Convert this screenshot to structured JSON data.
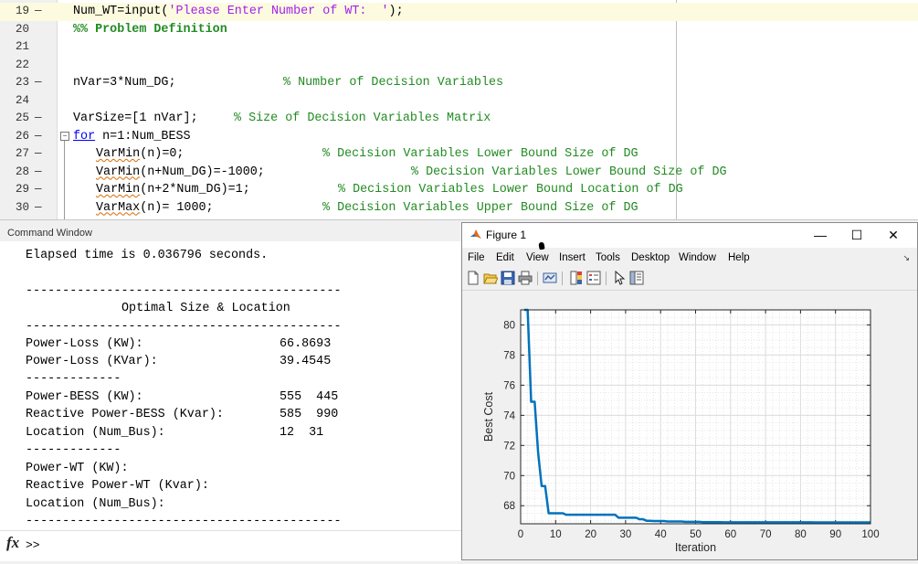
{
  "editor": {
    "lines": [
      {
        "num": "19",
        "dash": "—",
        "code": "Num_WT=input(",
        "str": "'Please Enter Number of WT:  '",
        "tail": ");",
        "highlight": true
      },
      {
        "num": "20",
        "dash": "",
        "section": "%% Problem Definition"
      },
      {
        "num": "21",
        "dash": ""
      },
      {
        "num": "22",
        "dash": ""
      },
      {
        "num": "23",
        "dash": "—",
        "code": "nVar=3*Num_DG;",
        "comment": "% Number of Decision Variables"
      },
      {
        "num": "24",
        "dash": ""
      },
      {
        "num": "25",
        "dash": "—",
        "code": "VarSize=[1 nVar];",
        "comment": "% Size of Decision Variables Matrix"
      },
      {
        "num": "26",
        "dash": "—",
        "kw": "for",
        "code": " n=1:Num_BESS"
      },
      {
        "num": "27",
        "dash": "—",
        "var": "VarMin",
        "code": "(n)=0;",
        "comment": "% Decision Variables Lower Bound Size of DG"
      },
      {
        "num": "28",
        "dash": "—",
        "var": "VarMin",
        "code": "(n+Num_DG)=-1000;",
        "comment": "% Decision Variables Lower Bound Size of DG"
      },
      {
        "num": "29",
        "dash": "—",
        "var": "VarMin",
        "code": "(n+2*Num_DG)=1;",
        "comment": "% Decision Variables Lower Bound Location of DG"
      },
      {
        "num": "30",
        "dash": "—",
        "var": "VarMax",
        "code": "(n)= 1000;",
        "comment": "% Decision Variables Upper Bound Size of DG"
      }
    ]
  },
  "command_window": {
    "title": "Command Window",
    "elapsed": "Elapsed time is 0.036796 seconds.",
    "separator_long": "-------------------------------------------",
    "separator_short": "-------------",
    "header": "Optimal Size & Location",
    "rows": [
      {
        "label": "Power-Loss (KW):",
        "value": "66.8693"
      },
      {
        "label": "Power-Loss (KVar):",
        "value": "39.4545"
      },
      {
        "label": "Power-BESS (KW):",
        "value": "555  445"
      },
      {
        "label": "Reactive Power-BESS (Kvar):",
        "value": "585  990"
      },
      {
        "label": "Location (Num_Bus):",
        "value": "12  31"
      },
      {
        "label": "Power-WT (KW):",
        "value": ""
      },
      {
        "label": "Reactive Power-WT (Kvar):",
        "value": ""
      },
      {
        "label": "Location (Num_Bus):",
        "value": ""
      }
    ],
    "fx_label": "fx",
    "prompt": ">>"
  },
  "figure": {
    "title": "Figure 1",
    "buttons": {
      "minimize": "—",
      "maximize": "☐",
      "close": "✕"
    },
    "menus": [
      "File",
      "Edit",
      "View",
      "Insert",
      "Tools",
      "Desktop",
      "Window",
      "Help"
    ],
    "menu_arrow": "↘",
    "toolbar_icons": [
      "new-figure-icon",
      "open-file-icon",
      "save-icon",
      "print-icon",
      "link-plot-icon",
      "colorbar-icon",
      "legend-icon",
      "pointer-icon",
      "property-editor-icon"
    ],
    "line_color": "#0072bd"
  },
  "chart_data": {
    "type": "line",
    "title": "",
    "xlabel": "Iteration",
    "ylabel": "Best Cost",
    "xlim": [
      0,
      100
    ],
    "ylim": [
      66.8,
      81
    ],
    "xticks": [
      0,
      10,
      20,
      30,
      40,
      50,
      60,
      70,
      80,
      90,
      100
    ],
    "yticks": [
      68,
      70,
      72,
      74,
      76,
      78,
      80
    ],
    "grid": true,
    "series": [
      {
        "name": "",
        "x": [
          1,
          2,
          3,
          4,
          5,
          6,
          7,
          8,
          9,
          10,
          11,
          12,
          13,
          14,
          15,
          16,
          17,
          18,
          19,
          20,
          21,
          22,
          23,
          24,
          25,
          26,
          27,
          28,
          29,
          30,
          31,
          32,
          33,
          34,
          35,
          36,
          37,
          38,
          39,
          40,
          41,
          42,
          43,
          44,
          45,
          46,
          47,
          48,
          49,
          50,
          51,
          52,
          53,
          54,
          55,
          56,
          57,
          58,
          59,
          60,
          61,
          62,
          63,
          64,
          65,
          66,
          67,
          68,
          69,
          70,
          71,
          72,
          73,
          74,
          75,
          76,
          77,
          78,
          79,
          80,
          81,
          82,
          83,
          84,
          85,
          86,
          87,
          88,
          89,
          90,
          91,
          92,
          93,
          94,
          95,
          96,
          97,
          98,
          99,
          100
        ],
        "y": [
          81.0,
          81.0,
          74.9,
          74.9,
          71.5,
          69.3,
          69.3,
          67.5,
          67.5,
          67.5,
          67.5,
          67.5,
          67.4,
          67.4,
          67.4,
          67.4,
          67.4,
          67.4,
          67.4,
          67.4,
          67.4,
          67.4,
          67.4,
          67.4,
          67.4,
          67.4,
          67.4,
          67.2,
          67.2,
          67.2,
          67.2,
          67.2,
          67.2,
          67.1,
          67.1,
          67.0,
          67.0,
          66.98,
          66.98,
          66.98,
          66.98,
          66.95,
          66.95,
          66.95,
          66.95,
          66.95,
          66.93,
          66.93,
          66.93,
          66.93,
          66.93,
          66.91,
          66.91,
          66.91,
          66.91,
          66.91,
          66.91,
          66.9,
          66.9,
          66.9,
          66.9,
          66.9,
          66.9,
          66.9,
          66.9,
          66.9,
          66.9,
          66.9,
          66.9,
          66.9,
          66.9,
          66.9,
          66.9,
          66.9,
          66.9,
          66.9,
          66.9,
          66.9,
          66.9,
          66.9,
          66.9,
          66.9,
          66.9,
          66.89,
          66.89,
          66.89,
          66.89,
          66.89,
          66.89,
          66.89,
          66.89,
          66.89,
          66.89,
          66.89,
          66.89,
          66.89,
          66.89,
          66.89,
          66.89,
          66.89
        ]
      }
    ]
  }
}
